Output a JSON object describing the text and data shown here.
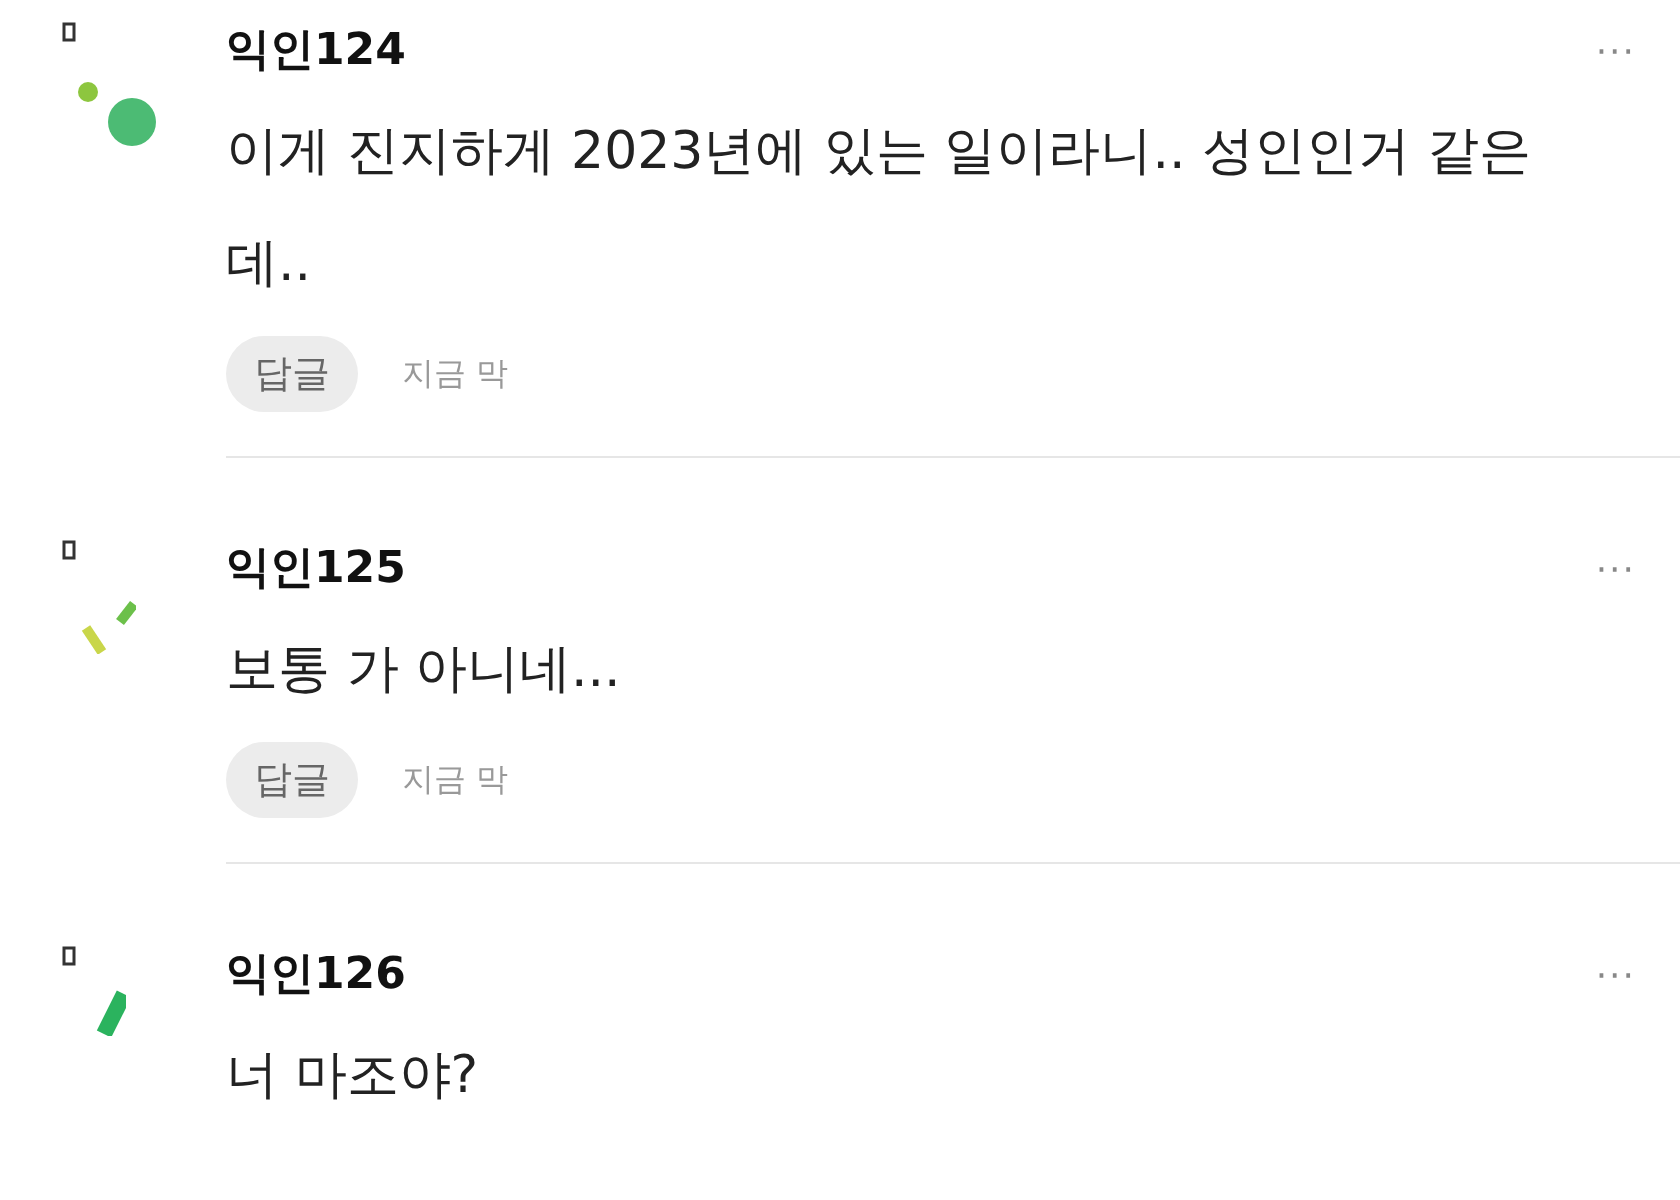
{
  "comments": [
    {
      "kind": "dots",
      "author": "익인124",
      "text": "이게 진지하게 2023년에 있는 일이라니.. 성인인거 같은데..",
      "reply": "답글",
      "time": "지금 막",
      "more": "···"
    },
    {
      "kind": "dashes",
      "author": "익인125",
      "text": "보통 가 아니네...",
      "reply": "답글",
      "time": "지금 막",
      "more": "···"
    },
    {
      "kind": "bar",
      "author": "익인126",
      "text": "너 마조야?",
      "more": "···"
    }
  ]
}
